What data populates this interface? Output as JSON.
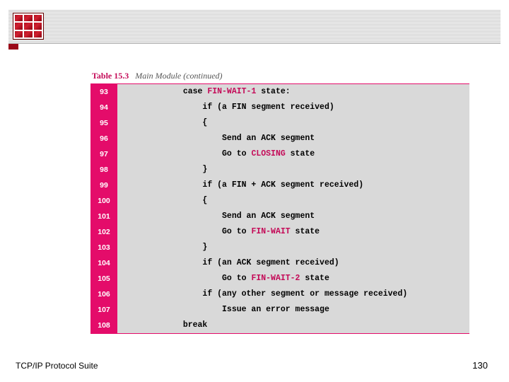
{
  "caption": {
    "label": "Table 15.3",
    "title": "Main Module (continued)"
  },
  "rows": [
    {
      "n": "93",
      "indent": 12,
      "parts": [
        [
          "case ",
          0
        ],
        [
          "FIN-WAIT-1",
          1
        ],
        [
          " state:",
          0
        ]
      ]
    },
    {
      "n": "94",
      "indent": 16,
      "parts": [
        [
          "if (a FIN segment received)",
          0
        ]
      ]
    },
    {
      "n": "95",
      "indent": 16,
      "parts": [
        [
          "{",
          0
        ]
      ]
    },
    {
      "n": "96",
      "indent": 20,
      "parts": [
        [
          "Send an ACK segment",
          0
        ]
      ]
    },
    {
      "n": "97",
      "indent": 20,
      "parts": [
        [
          "Go to ",
          0
        ],
        [
          "CLOSING",
          1
        ],
        [
          " state",
          0
        ]
      ]
    },
    {
      "n": "98",
      "indent": 16,
      "parts": [
        [
          "}",
          0
        ]
      ]
    },
    {
      "n": "99",
      "indent": 16,
      "parts": [
        [
          "if (a FIN + ACK segment received)",
          0
        ]
      ]
    },
    {
      "n": "100",
      "indent": 16,
      "parts": [
        [
          "{",
          0
        ]
      ]
    },
    {
      "n": "101",
      "indent": 20,
      "parts": [
        [
          "Send an ACK segment",
          0
        ]
      ]
    },
    {
      "n": "102",
      "indent": 20,
      "parts": [
        [
          "Go to ",
          0
        ],
        [
          "FIN-WAIT",
          1
        ],
        [
          " state",
          0
        ]
      ]
    },
    {
      "n": "103",
      "indent": 16,
      "parts": [
        [
          "}",
          0
        ]
      ]
    },
    {
      "n": "104",
      "indent": 16,
      "parts": [
        [
          "if (an ACK segment received)",
          0
        ]
      ]
    },
    {
      "n": "105",
      "indent": 20,
      "parts": [
        [
          "Go to ",
          0
        ],
        [
          "FIN-WAIT-2",
          1
        ],
        [
          " state",
          0
        ]
      ]
    },
    {
      "n": "106",
      "indent": 16,
      "parts": [
        [
          "if (any other segment or message received)",
          0
        ]
      ]
    },
    {
      "n": "107",
      "indent": 20,
      "parts": [
        [
          "Issue an error message",
          0
        ]
      ]
    },
    {
      "n": "108",
      "indent": 12,
      "parts": [
        [
          "break",
          0
        ]
      ]
    }
  ],
  "footer": {
    "left": "TCP/IP Protocol Suite",
    "right": "130"
  }
}
